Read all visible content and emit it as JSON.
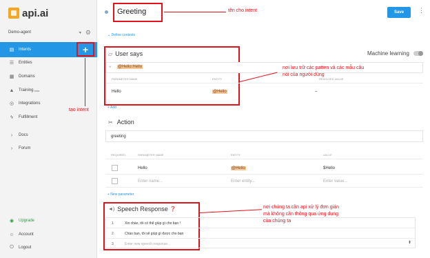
{
  "app": {
    "logo_text": "api.ai"
  },
  "sidebar": {
    "agent_name": "Demo-agent",
    "items": [
      {
        "label": "Intents",
        "icon": "chat-icon"
      },
      {
        "label": "Entities",
        "icon": "list-icon"
      },
      {
        "label": "Domains",
        "icon": "domains-icon"
      },
      {
        "label": "Training",
        "badge": "beta",
        "icon": "graduation-icon"
      },
      {
        "label": "Integrations",
        "icon": "integrations-icon"
      },
      {
        "label": "Fulfillment",
        "icon": "lightning-icon"
      },
      {
        "label": "Docs",
        "icon": "chevron-right-icon"
      },
      {
        "label": "Forum",
        "icon": "chevron-right-icon"
      },
      {
        "label": "Upgrade",
        "icon": "upgrade-icon"
      },
      {
        "label": "Account",
        "icon": "account-icon"
      },
      {
        "label": "Logout",
        "icon": "power-icon"
      }
    ],
    "plus_label": "+",
    "annotation_create_intent": "tạo intent"
  },
  "header": {
    "intent_name": "Greeting",
    "annotation_intent_name": "tên cho intent",
    "save_label": "Save",
    "define_contexts": "Define contexts"
  },
  "user_says": {
    "title": "User says",
    "machine_learning_label": "Machine learning",
    "example": "@Hello:Hello",
    "param_headers": [
      "PARAMETER NAME",
      "ENTITY",
      "RESOLVED VALUE"
    ],
    "param_row": {
      "name": "Hello",
      "entity": "@Hello",
      "value": "–"
    },
    "add_label": "+ Add",
    "annotation": "nơi lưu trữ các patten và các mẫu câu nói của người dùng"
  },
  "action": {
    "title": "Action",
    "value": "greeting",
    "headers": [
      "REQUIRED",
      "PARAMETER NAME",
      "ENTITY",
      "VALUE"
    ],
    "rows": [
      {
        "name": "Hello",
        "entity": "@Hello",
        "value": "$Hello"
      }
    ],
    "new_row_placeholders": {
      "name": "Enter name...",
      "entity": "Enter entity...",
      "value": "Enter value..."
    },
    "new_parameter_label": "+ New parameter"
  },
  "speech_response": {
    "title": "Speech Response",
    "rows": [
      {
        "num": "1",
        "text": "Xin chào, tôi có thể giúp gì cho bạn !"
      },
      {
        "num": "2",
        "text": "Chào bạn, tôi sẽ giúp gì được cho bạn"
      },
      {
        "num": "3",
        "text": "Enter new speech response..."
      }
    ],
    "annotation": "nơi chúng ta cần api xử lý đơn giản mà không cần thông qua ứng dụng của chúng ta"
  },
  "colors": {
    "accent": "#2396e6",
    "annotation_red": "#e0121b",
    "highlight": "#f7c89a"
  }
}
